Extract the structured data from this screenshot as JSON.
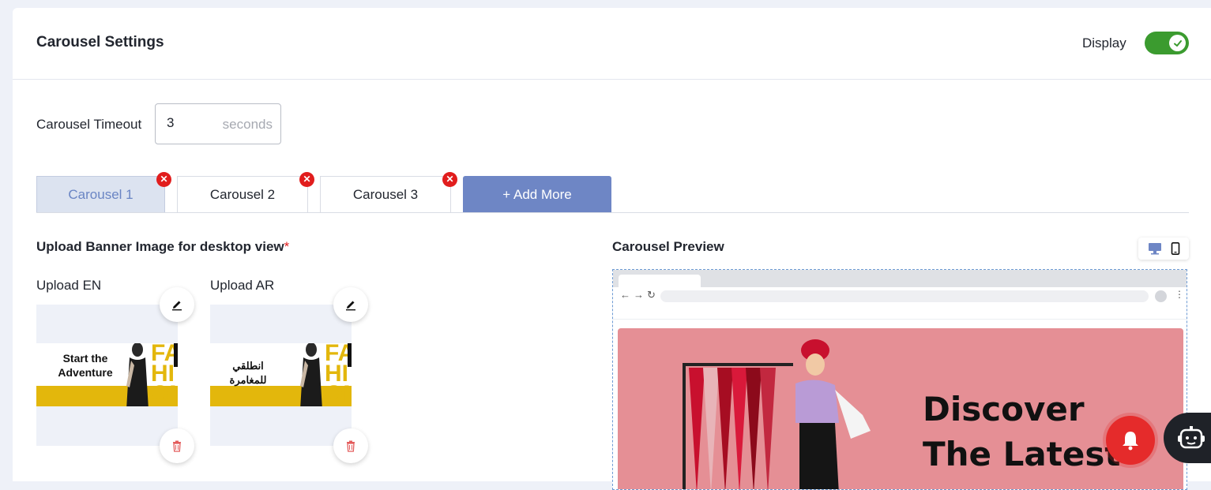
{
  "header": {
    "title": "Carousel Settings",
    "display_label": "Display",
    "display_on": true
  },
  "timeout": {
    "label": "Carousel Timeout",
    "value": "3",
    "unit": "seconds"
  },
  "tabs": [
    {
      "label": "Carousel 1",
      "active": true
    },
    {
      "label": "Carousel 2",
      "active": false
    },
    {
      "label": "Carousel 3",
      "active": false
    }
  ],
  "add_more_label": "+ Add More",
  "upload": {
    "title": "Upload Banner Image for desktop view",
    "required_mark": "*",
    "en_label": "Upload EN",
    "ar_label": "Upload AR",
    "en_banner_text": "Start the Adventure",
    "ar_banner_text": "انطلقي للمغامرة",
    "banner_brand_text": "FA HI ON"
  },
  "preview": {
    "title": "Carousel Preview",
    "hero_text_line1": "Discover",
    "hero_text_line2": "The Latest"
  },
  "colors": {
    "accent": "#6e86c5",
    "toggle_on": "#3b9b2f",
    "danger": "#e11d1d",
    "banner_yellow": "#e3b70c",
    "hero_pink": "#e58f95"
  }
}
